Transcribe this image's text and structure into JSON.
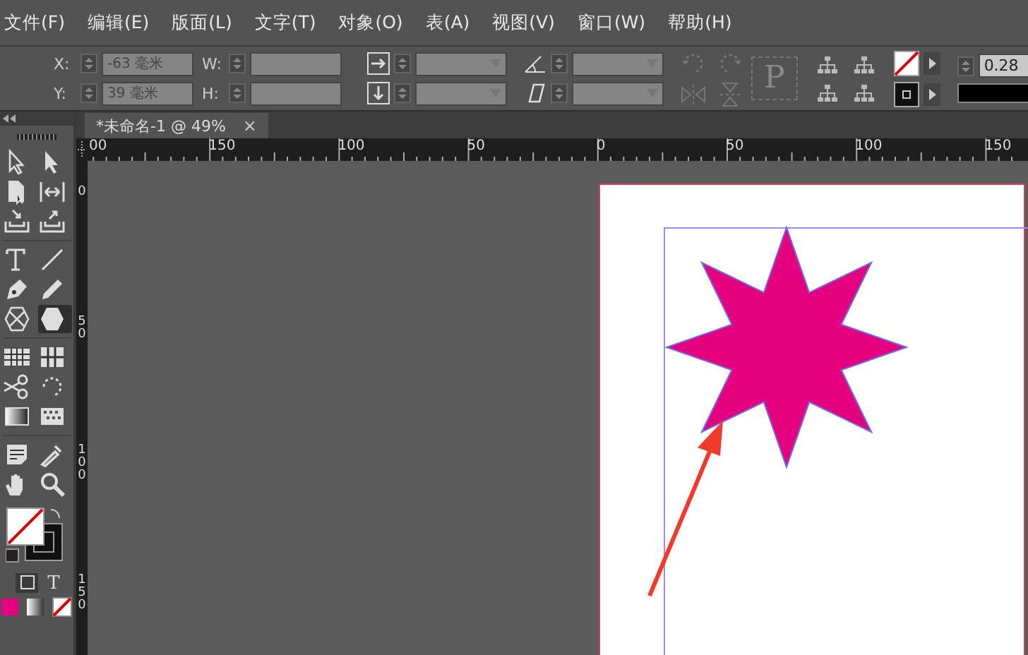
{
  "menu": [
    {
      "label": "文件(F)"
    },
    {
      "label": "编辑(E)"
    },
    {
      "label": "版面(L)"
    },
    {
      "label": "文字(T)"
    },
    {
      "label": "对象(O)"
    },
    {
      "label": "表(A)"
    },
    {
      "label": "视图(V)"
    },
    {
      "label": "窗口(W)"
    },
    {
      "label": "帮助(H)"
    }
  ],
  "control_panel": {
    "x_label": "X:",
    "x_value": "-63 毫米",
    "y_label": "Y:",
    "y_value": "39 毫米",
    "w_label": "W:",
    "h_label": "H:",
    "frame_glyph": "P",
    "stroke_weight": "0.28"
  },
  "document_tab": {
    "title": "*未命名-1 @ 49%",
    "close": "×",
    "selected": true
  },
  "horizontal_ruler": [
    "00",
    "150",
    "100",
    "50",
    "0",
    "50",
    "100",
    "150"
  ],
  "vertical_ruler": [
    "0",
    "50",
    "100",
    "150"
  ],
  "tools": [
    {
      "kind": "select",
      "selected": false
    },
    {
      "kind": "direct",
      "selected": false
    },
    {
      "kind": "page",
      "selected": false
    },
    {
      "kind": "gap",
      "selected": false
    },
    {
      "kind": "collect",
      "selected": false
    },
    {
      "kind": "place",
      "selected": false
    },
    {
      "kind": "type",
      "selected": false
    },
    {
      "kind": "line",
      "selected": false
    },
    {
      "kind": "pen",
      "selected": false
    },
    {
      "kind": "pencil",
      "selected": false
    },
    {
      "kind": "frame",
      "selected": false
    },
    {
      "kind": "polygon",
      "selected": true
    },
    {
      "kind": "table",
      "selected": false
    },
    {
      "kind": "grid",
      "selected": false
    },
    {
      "kind": "scissors",
      "selected": false
    },
    {
      "kind": "rotate",
      "selected": false
    },
    {
      "kind": "gradient",
      "selected": false
    },
    {
      "kind": "feather",
      "selected": false
    },
    {
      "kind": "note",
      "selected": false
    },
    {
      "kind": "eyedropper",
      "selected": false
    },
    {
      "kind": "hand",
      "selected": false
    },
    {
      "kind": "zoom",
      "selected": false
    }
  ],
  "format_toggle": {
    "text_glyph": "T"
  },
  "shape": {
    "color": "#e4007f"
  }
}
